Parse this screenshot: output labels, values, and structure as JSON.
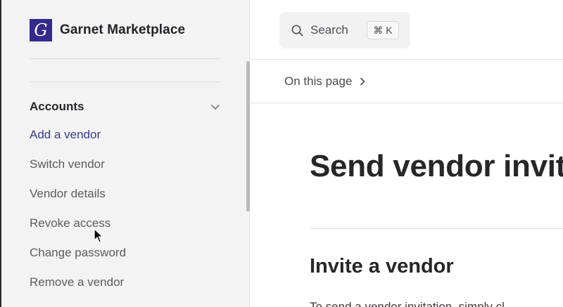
{
  "brand": {
    "name": "Garnet Marketplace",
    "logo_letter": "G",
    "logo_color": "#332a8c"
  },
  "sidebar": {
    "section": {
      "title": "Accounts",
      "expanded": true
    },
    "items": [
      {
        "label": "Add a vendor",
        "active": true
      },
      {
        "label": "Switch vendor",
        "active": false
      },
      {
        "label": "Vendor details",
        "active": false
      },
      {
        "label": "Revoke access",
        "active": false
      },
      {
        "label": "Change password",
        "active": false
      },
      {
        "label": "Remove a vendor",
        "active": false
      }
    ],
    "active_color": "#3b3a8c"
  },
  "header": {
    "search": {
      "label": "Search",
      "shortcut": "⌘K"
    },
    "on_this_page": "On this page"
  },
  "main": {
    "title": "Send vendor invita",
    "section_heading": "Invite a vendor",
    "body_text": "To send a vendor invitation, simply cl"
  }
}
